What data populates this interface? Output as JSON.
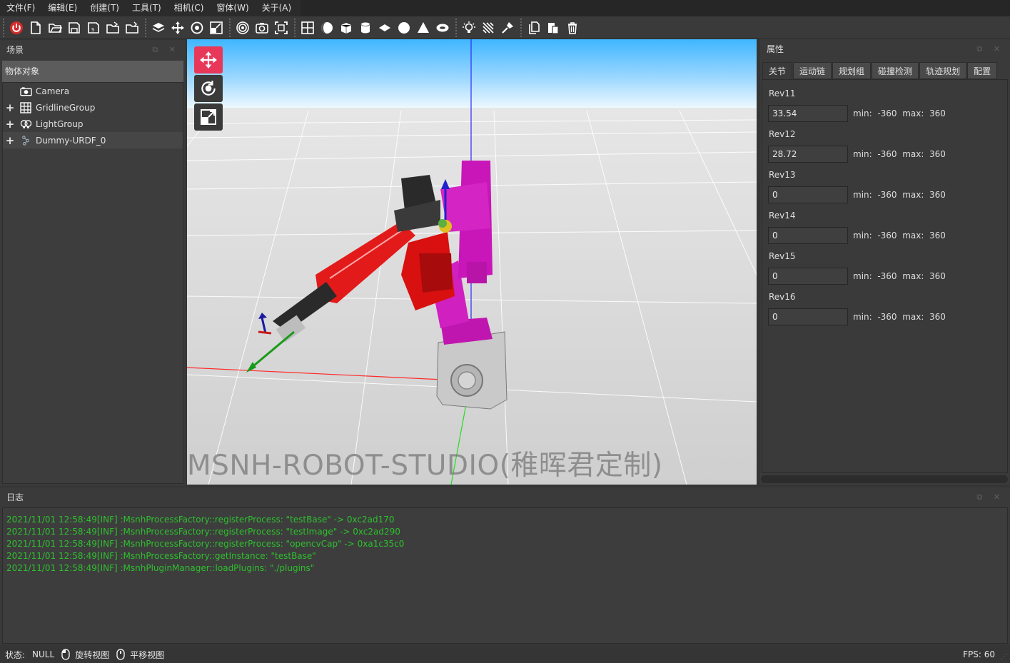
{
  "menu": {
    "items": [
      "文件(F)",
      "编辑(E)",
      "创建(T)",
      "工具(T)",
      "相机(C)",
      "窗体(W)",
      "关于(A)"
    ]
  },
  "toolbar": {
    "groups": [
      [
        "power-icon",
        "new-file-icon",
        "open-folder-icon",
        "save-icon",
        "save-as-icon",
        "import-icon",
        "export-icon"
      ],
      [
        "layers-icon",
        "move-icon",
        "rotate-view-icon",
        "scale-icon"
      ],
      [
        "target-icon",
        "camera-icon",
        "fit-view-icon"
      ],
      [
        "grid-icon",
        "sphere-shaded-icon",
        "cube-icon",
        "cylinder-icon",
        "plane-icon",
        "sphere-icon",
        "cone-icon",
        "torus-icon"
      ],
      [
        "light-bulb-icon",
        "directional-light-icon",
        "spot-light-icon"
      ],
      [
        "copy-icon",
        "paste-icon",
        "delete-icon"
      ]
    ]
  },
  "scene_panel": {
    "title": "场景",
    "header": "物体对象",
    "items": [
      {
        "label": "Camera",
        "expandable": false,
        "icon": "camera-icon"
      },
      {
        "label": "GridlineGroup",
        "expandable": true,
        "icon": "grid-icon"
      },
      {
        "label": "LightGroup",
        "expandable": true,
        "icon": "light-group-icon"
      },
      {
        "label": "Dummy-URDF_0",
        "expandable": true,
        "icon": "robot-icon"
      }
    ]
  },
  "viewport": {
    "watermark": "MSNH-ROBOT-STUDIO(稚晖君定制)",
    "buttons": [
      "move-mode-icon",
      "orbit-mode-icon",
      "scale-mode-icon"
    ]
  },
  "properties": {
    "title": "属性",
    "tabs": [
      "关节",
      "运动链",
      "规划组",
      "碰撞检测",
      "轨迹规划",
      "配置"
    ],
    "active_tab": "关节",
    "joints": [
      {
        "name": "Rev11",
        "value": "33.54",
        "min": "-360",
        "max": "360"
      },
      {
        "name": "Rev12",
        "value": "28.72",
        "min": "-360",
        "max": "360"
      },
      {
        "name": "Rev13",
        "value": "0",
        "min": "-360",
        "max": "360"
      },
      {
        "name": "Rev14",
        "value": "0",
        "min": "-360",
        "max": "360"
      },
      {
        "name": "Rev15",
        "value": "0",
        "min": "-360",
        "max": "360"
      },
      {
        "name": "Rev16",
        "value": "0",
        "min": "-360",
        "max": "360"
      }
    ],
    "min_label": "min:",
    "max_label": "max:"
  },
  "log": {
    "title": "日志",
    "lines": [
      "2021/11/01 12:58:49[INF] :MsnhProcessFactory::registerProcess: \"testBase\" -> 0xc2ad170",
      "2021/11/01 12:58:49[INF] :MsnhProcessFactory::registerProcess: \"testImage\" -> 0xc2ad290",
      "2021/11/01 12:58:49[INF] :MsnhProcessFactory::registerProcess: \"opencvCap\" -> 0xa1c35c0",
      "2021/11/01 12:58:49[INF] :MsnhProcessFactory::getInstance: \"testBase\"",
      "2021/11/01 12:58:49[INF] :MsnhPluginManager::loadPlugins: \"./plugins\""
    ]
  },
  "statusbar": {
    "status_label": "状态:",
    "status_value": "NULL",
    "rotate_view": "旋转视图",
    "pan_view": "平移视图",
    "fps": "FPS: 60"
  },
  "colors": {
    "log_text": "#2ec02e",
    "accent_red": "#e8385a",
    "robot_red": "#e01010",
    "robot_magenta": "#d020c0"
  }
}
